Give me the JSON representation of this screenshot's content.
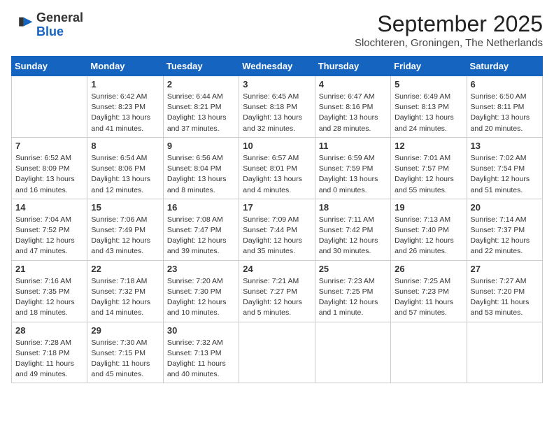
{
  "header": {
    "logo_general": "General",
    "logo_blue": "Blue",
    "month": "September 2025",
    "location": "Slochteren, Groningen, The Netherlands"
  },
  "days_of_week": [
    "Sunday",
    "Monday",
    "Tuesday",
    "Wednesday",
    "Thursday",
    "Friday",
    "Saturday"
  ],
  "weeks": [
    [
      {
        "day": "",
        "info": ""
      },
      {
        "day": "1",
        "info": "Sunrise: 6:42 AM\nSunset: 8:23 PM\nDaylight: 13 hours\nand 41 minutes."
      },
      {
        "day": "2",
        "info": "Sunrise: 6:44 AM\nSunset: 8:21 PM\nDaylight: 13 hours\nand 37 minutes."
      },
      {
        "day": "3",
        "info": "Sunrise: 6:45 AM\nSunset: 8:18 PM\nDaylight: 13 hours\nand 32 minutes."
      },
      {
        "day": "4",
        "info": "Sunrise: 6:47 AM\nSunset: 8:16 PM\nDaylight: 13 hours\nand 28 minutes."
      },
      {
        "day": "5",
        "info": "Sunrise: 6:49 AM\nSunset: 8:13 PM\nDaylight: 13 hours\nand 24 minutes."
      },
      {
        "day": "6",
        "info": "Sunrise: 6:50 AM\nSunset: 8:11 PM\nDaylight: 13 hours\nand 20 minutes."
      }
    ],
    [
      {
        "day": "7",
        "info": "Sunrise: 6:52 AM\nSunset: 8:09 PM\nDaylight: 13 hours\nand 16 minutes."
      },
      {
        "day": "8",
        "info": "Sunrise: 6:54 AM\nSunset: 8:06 PM\nDaylight: 13 hours\nand 12 minutes."
      },
      {
        "day": "9",
        "info": "Sunrise: 6:56 AM\nSunset: 8:04 PM\nDaylight: 13 hours\nand 8 minutes."
      },
      {
        "day": "10",
        "info": "Sunrise: 6:57 AM\nSunset: 8:01 PM\nDaylight: 13 hours\nand 4 minutes."
      },
      {
        "day": "11",
        "info": "Sunrise: 6:59 AM\nSunset: 7:59 PM\nDaylight: 13 hours\nand 0 minutes."
      },
      {
        "day": "12",
        "info": "Sunrise: 7:01 AM\nSunset: 7:57 PM\nDaylight: 12 hours\nand 55 minutes."
      },
      {
        "day": "13",
        "info": "Sunrise: 7:02 AM\nSunset: 7:54 PM\nDaylight: 12 hours\nand 51 minutes."
      }
    ],
    [
      {
        "day": "14",
        "info": "Sunrise: 7:04 AM\nSunset: 7:52 PM\nDaylight: 12 hours\nand 47 minutes."
      },
      {
        "day": "15",
        "info": "Sunrise: 7:06 AM\nSunset: 7:49 PM\nDaylight: 12 hours\nand 43 minutes."
      },
      {
        "day": "16",
        "info": "Sunrise: 7:08 AM\nSunset: 7:47 PM\nDaylight: 12 hours\nand 39 minutes."
      },
      {
        "day": "17",
        "info": "Sunrise: 7:09 AM\nSunset: 7:44 PM\nDaylight: 12 hours\nand 35 minutes."
      },
      {
        "day": "18",
        "info": "Sunrise: 7:11 AM\nSunset: 7:42 PM\nDaylight: 12 hours\nand 30 minutes."
      },
      {
        "day": "19",
        "info": "Sunrise: 7:13 AM\nSunset: 7:40 PM\nDaylight: 12 hours\nand 26 minutes."
      },
      {
        "day": "20",
        "info": "Sunrise: 7:14 AM\nSunset: 7:37 PM\nDaylight: 12 hours\nand 22 minutes."
      }
    ],
    [
      {
        "day": "21",
        "info": "Sunrise: 7:16 AM\nSunset: 7:35 PM\nDaylight: 12 hours\nand 18 minutes."
      },
      {
        "day": "22",
        "info": "Sunrise: 7:18 AM\nSunset: 7:32 PM\nDaylight: 12 hours\nand 14 minutes."
      },
      {
        "day": "23",
        "info": "Sunrise: 7:20 AM\nSunset: 7:30 PM\nDaylight: 12 hours\nand 10 minutes."
      },
      {
        "day": "24",
        "info": "Sunrise: 7:21 AM\nSunset: 7:27 PM\nDaylight: 12 hours\nand 5 minutes."
      },
      {
        "day": "25",
        "info": "Sunrise: 7:23 AM\nSunset: 7:25 PM\nDaylight: 12 hours\nand 1 minute."
      },
      {
        "day": "26",
        "info": "Sunrise: 7:25 AM\nSunset: 7:23 PM\nDaylight: 11 hours\nand 57 minutes."
      },
      {
        "day": "27",
        "info": "Sunrise: 7:27 AM\nSunset: 7:20 PM\nDaylight: 11 hours\nand 53 minutes."
      }
    ],
    [
      {
        "day": "28",
        "info": "Sunrise: 7:28 AM\nSunset: 7:18 PM\nDaylight: 11 hours\nand 49 minutes."
      },
      {
        "day": "29",
        "info": "Sunrise: 7:30 AM\nSunset: 7:15 PM\nDaylight: 11 hours\nand 45 minutes."
      },
      {
        "day": "30",
        "info": "Sunrise: 7:32 AM\nSunset: 7:13 PM\nDaylight: 11 hours\nand 40 minutes."
      },
      {
        "day": "",
        "info": ""
      },
      {
        "day": "",
        "info": ""
      },
      {
        "day": "",
        "info": ""
      },
      {
        "day": "",
        "info": ""
      }
    ]
  ]
}
